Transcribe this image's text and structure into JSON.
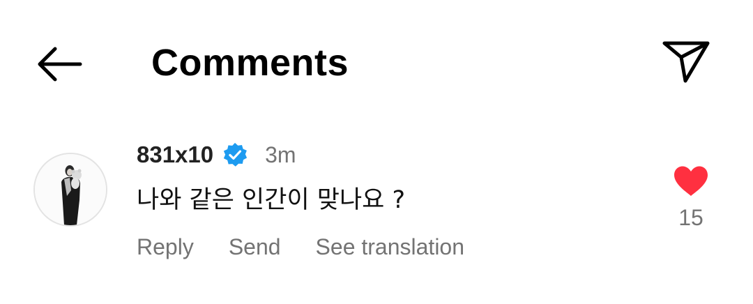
{
  "header": {
    "title": "Comments",
    "back_icon": "arrow-left-icon",
    "share_icon": "paper-plane-icon"
  },
  "comment": {
    "username": "831x10",
    "verified": true,
    "time": "3m",
    "text": "나와 같은 인간이 맞나요 ?",
    "actions": {
      "reply": "Reply",
      "send": "Send",
      "translate": "See translation"
    },
    "like_count": "15",
    "liked": true
  },
  "colors": {
    "verified_badge": "#1d9bf0",
    "like_heart": "#ff3040",
    "secondary_text": "#737373"
  }
}
